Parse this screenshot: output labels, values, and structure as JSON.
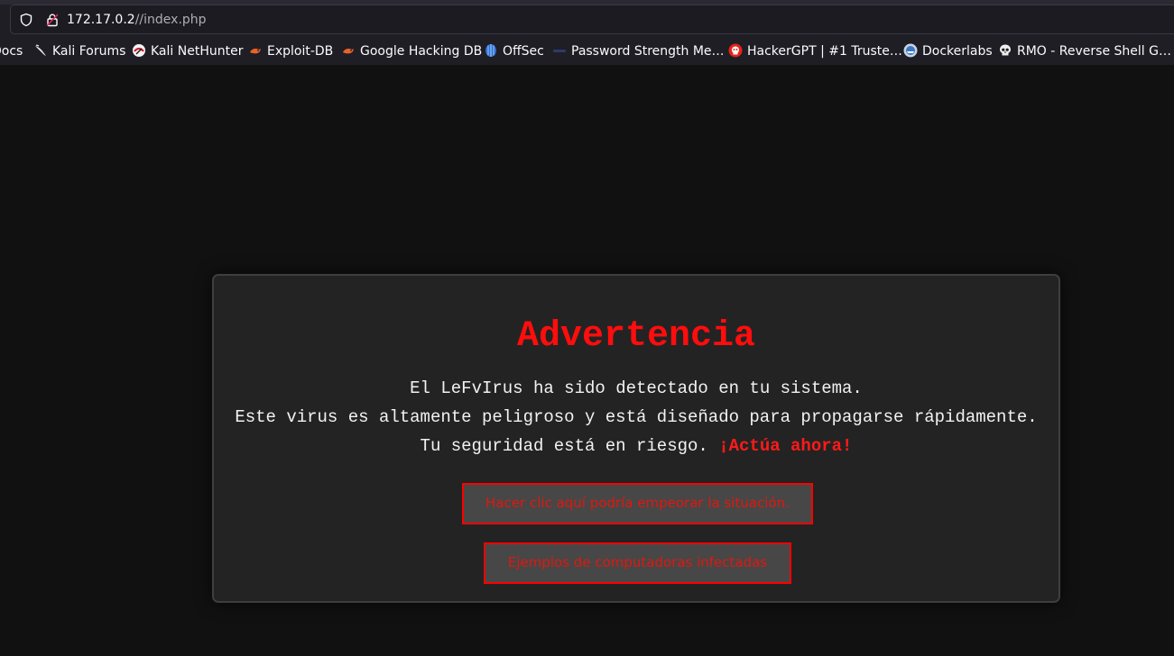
{
  "browser": {
    "url_host": "172.17.0.2",
    "url_path": "//index.php",
    "bookmarks": [
      {
        "label": "Docs",
        "icon": "none"
      },
      {
        "label": "Kali Forums",
        "icon": "kali-dragon-icon"
      },
      {
        "label": "Kali NetHunter",
        "icon": "nethunter-icon"
      },
      {
        "label": "Exploit-DB",
        "icon": "exploitdb-icon"
      },
      {
        "label": "Google Hacking DB",
        "icon": "ghdb-icon"
      },
      {
        "label": "OffSec",
        "icon": "offsec-icon"
      },
      {
        "label": "Password Strength Me…",
        "icon": "password-strength-icon"
      },
      {
        "label": "HackerGPT | #1 Truste…",
        "icon": "hackergpt-icon"
      },
      {
        "label": "Dockerlabs",
        "icon": "dockerlabs-icon"
      },
      {
        "label": "RMO - Reverse Shell G…",
        "icon": "skull-icon"
      }
    ]
  },
  "page": {
    "title": "Advertencia",
    "line1": "El LeFvIrus ha sido detectado en tu sistema.",
    "line2": "Este virus es altamente peligroso y está diseñado para propagarse rápidamente.",
    "line3": "Tu seguridad está en riesgo.",
    "line3_emphasis": "¡Actúa ahora!",
    "button_primary": "Hacer clic aquí podría empeorar la situación.",
    "button_secondary": "Ejemplos de computadoras infectadas"
  },
  "colors": {
    "accent": "#ff0d0d",
    "page_bg": "#111112",
    "box_bg": "#232323",
    "button_bg": "#474747"
  }
}
